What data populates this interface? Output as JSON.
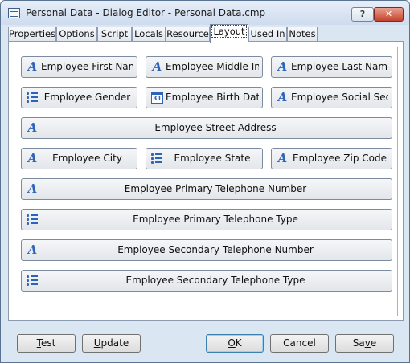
{
  "window": {
    "title": "Personal Data - Dialog Editor - Personal Data.cmp",
    "help_label": "?",
    "close_label": "✕"
  },
  "tabs": [
    {
      "label": "Properties"
    },
    {
      "label": "Options"
    },
    {
      "label": "Script"
    },
    {
      "label": "Locals"
    },
    {
      "label": "Resource"
    },
    {
      "label": "Layout",
      "active": true
    },
    {
      "label": "Used In"
    },
    {
      "label": "Notes"
    }
  ],
  "layout": {
    "fields": [
      {
        "label": "Employee First Name",
        "icon": "text-field-icon"
      },
      {
        "label": "Employee Middle In...",
        "icon": "text-field-icon"
      },
      {
        "label": "Employee Last Name",
        "icon": "text-field-icon"
      },
      {
        "label": "Employee Gender",
        "icon": "list-icon"
      },
      {
        "label": "Employee Birth Date",
        "icon": "calendar-icon",
        "icon_text": "31"
      },
      {
        "label": "Employee Social Sec...",
        "icon": "text-field-icon"
      },
      {
        "label": "Employee Street Address",
        "icon": "text-field-icon"
      },
      {
        "label": "Employee City",
        "icon": "text-field-icon"
      },
      {
        "label": "Employee State",
        "icon": "list-icon"
      },
      {
        "label": "Employee Zip Code",
        "icon": "text-field-icon"
      },
      {
        "label": "Employee Primary Telephone Number",
        "icon": "text-field-icon"
      },
      {
        "label": "Employee Primary Telephone Type",
        "icon": "list-icon"
      },
      {
        "label": "Employee Secondary Telephone Number",
        "icon": "text-field-icon"
      },
      {
        "label": "Employee Secondary Telephone Type",
        "icon": "list-icon"
      }
    ]
  },
  "buttons": {
    "test": {
      "mnemonic": "T",
      "rest": "est"
    },
    "update": {
      "mnemonic": "U",
      "rest": "pdate"
    },
    "ok": {
      "mnemonic": "O",
      "rest": "K"
    },
    "cancel": {
      "label": "Cancel"
    },
    "save": {
      "before": "Sa",
      "mnemonic": "v",
      "rest": "e"
    }
  },
  "colors": {
    "icon_blue": "#2b64b8",
    "window_frame": "#dbe6f3"
  }
}
